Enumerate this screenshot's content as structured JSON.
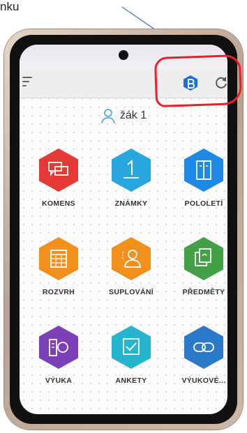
{
  "caption": "nku",
  "colors": {
    "annotation": "#e8202a",
    "arrow": "#4a72c4",
    "appbar": "#eeeeee"
  },
  "appbar": {
    "menu_icon": "hamburger-icon",
    "logo_icon": "bakalari-logo-icon",
    "refresh_icon": "refresh-icon"
  },
  "user": {
    "icon": "student-avatar-icon",
    "name": "žák 1"
  },
  "tiles": [
    {
      "label": "KOMENS",
      "color": "#e53935",
      "icon": "chat-bubbles-icon"
    },
    {
      "label": "ZNÁMKY",
      "color": "#29a8e0",
      "icon": "grade-one-icon"
    },
    {
      "label": "POLOLETÍ",
      "color": "#1e88e5",
      "icon": "report-book-icon"
    },
    {
      "label": "ROZVRH",
      "color": "#f2901e",
      "icon": "timetable-icon"
    },
    {
      "label": "SUPLOVÁNÍ",
      "color": "#f2901e",
      "icon": "substitute-person-icon"
    },
    {
      "label": "PŘEDMĚTY",
      "color": "#43a047",
      "icon": "subjects-copy-icon"
    },
    {
      "label": "VÝUKA",
      "color": "#7b3fb8",
      "icon": "lesson-book-icon"
    },
    {
      "label": "ANKETY",
      "color": "#26b5cf",
      "icon": "survey-check-icon"
    },
    {
      "label": "VÝUKOVÉ...",
      "color": "#2b79c9",
      "icon": "link-icon"
    }
  ]
}
